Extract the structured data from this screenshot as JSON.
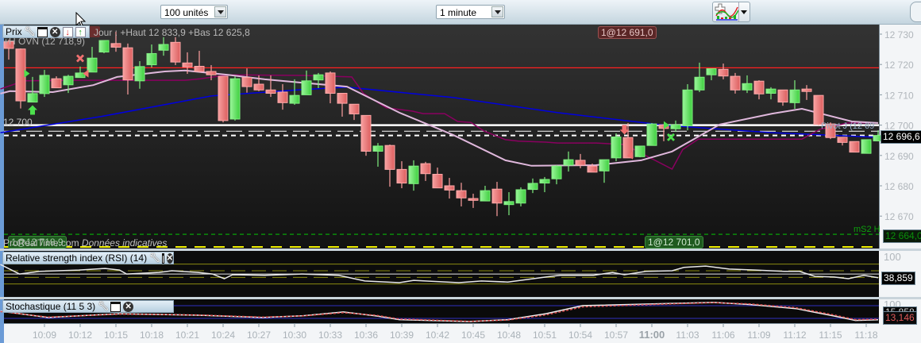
{
  "toolbar": {
    "quantity_select": "100 unités",
    "interval_select": "1 minute",
    "indicator_button": "indicators-icon"
  },
  "price_pane": {
    "title": "Prix",
    "day_stats": "Jour : +Haut 12 833,9 +Bas 12 625,8",
    "h_ovn_label": "+H OVN (12 718,9)",
    "level_12700_label": "12 700",
    "pivot_label": "Pivot J (12 69",
    "ms2_label": "mS2 H",
    "order_top_label": "1@12 691,0",
    "order_bottom_label": "1@12 701,0",
    "order_left_label": "1@12 718,9",
    "watermark": "ProRealTime.com",
    "disclaimer": "Données indicatives",
    "current_price": "12 696,6",
    "ms2_price": "12 664,0",
    "axis_ticks": [
      "12 730",
      "12 720",
      "12 710",
      "12 700",
      "12 690",
      "12 680",
      "12 670"
    ]
  },
  "rsi_pane": {
    "title": "Relative strength index (RSI) (14)",
    "axis_top": "100",
    "value": "38,859"
  },
  "stoch_pane": {
    "title": "Stochastique (11 5 3)",
    "axis_top": "100",
    "value_signal": "15,858",
    "value_main": "13,146"
  },
  "time_axis": [
    "10:09",
    "10:12",
    "10:15",
    "10:18",
    "10:21",
    "10:24",
    "10:27",
    "10:30",
    "10:33",
    "10:36",
    "10:39",
    "10:42",
    "10:45",
    "10:48",
    "10:51",
    "10:54",
    "10:57",
    "11:00",
    "11:03",
    "11:06",
    "11:09",
    "11:12",
    "11:15",
    "11:18"
  ],
  "colors": {
    "up": "#5ee05e",
    "down": "#f08484",
    "ma_slow": "#0000e0",
    "ma_fast": "#e0b8dc",
    "ma_purple": "#8a0060",
    "h_ovn": "#ff2020",
    "ms2": "#0a8a0a"
  },
  "chart_data": {
    "type": "candlestick",
    "title": "Prix",
    "xlabel": "",
    "ylabel": "",
    "x_unit": "1-minute bar index (bar 3 = 10:09, bar 72 = 11:18)",
    "ylim": [
      12662,
      12733
    ],
    "ohlc": [
      [
        12727.6,
        12728.2,
        12721.6,
        12725.3
      ],
      [
        12725.1,
        12725.3,
        12705.5,
        12708.0
      ],
      [
        12707.6,
        12715.9,
        12707.6,
        12710.4
      ],
      [
        12710.4,
        12718.2,
        12709.3,
        12716.4
      ],
      [
        12715.3,
        12716.1,
        12712.3,
        12712.3
      ],
      [
        12713.3,
        12716.6,
        12710.6,
        12716.1
      ],
      [
        12715.7,
        12719.3,
        12715.7,
        12717.2
      ],
      [
        12717.5,
        12725.8,
        12717.5,
        12722.1
      ],
      [
        12724.1,
        12727.9,
        12723.7,
        12727.9
      ],
      [
        12726.9,
        12730.8,
        12724.2,
        12725.7
      ],
      [
        12725.5,
        12726.9,
        12710.1,
        12714.9
      ],
      [
        12714.6,
        12721.1,
        12712.0,
        12719.3
      ],
      [
        12719.9,
        12726.6,
        12719.0,
        12723.6
      ],
      [
        12724.7,
        12729.0,
        12722.9,
        12726.6
      ],
      [
        12727.3,
        12729.0,
        12719.8,
        12720.8
      ],
      [
        12720.5,
        12724.0,
        12716.9,
        12719.2
      ],
      [
        12719.4,
        12724.5,
        12717.4,
        12717.7
      ],
      [
        12717.7,
        12719.8,
        12714.8,
        12716.6
      ],
      [
        12716.1,
        12716.1,
        12700.9,
        12701.5
      ],
      [
        12702.0,
        12716.1,
        12701.5,
        12715.3
      ],
      [
        12715.7,
        12718.7,
        12710.7,
        12712.7
      ],
      [
        12713.5,
        12716.4,
        12711.2,
        12711.6
      ],
      [
        12711.6,
        12716.4,
        12709.3,
        12710.5
      ],
      [
        12710.9,
        12713.5,
        12705.1,
        12707.4
      ],
      [
        12707.2,
        12715.1,
        12706.7,
        12709.8
      ],
      [
        12710.0,
        12718.0,
        12710.0,
        12714.6
      ],
      [
        12714.9,
        12717.2,
        12712.2,
        12716.6
      ],
      [
        12717.2,
        12717.7,
        12707.2,
        12710.5
      ],
      [
        12710.5,
        12710.5,
        12702.8,
        12707.2
      ],
      [
        12706.9,
        12706.9,
        12701.7,
        12703.7
      ],
      [
        12703.2,
        12703.2,
        12689.9,
        12691.4
      ],
      [
        12691.4,
        12694.1,
        12686.3,
        12693.1
      ],
      [
        12693.3,
        12693.6,
        12679.7,
        12685.4
      ],
      [
        12685.4,
        12688.1,
        12679.2,
        12680.9
      ],
      [
        12680.7,
        12688.4,
        12678.4,
        12686.5
      ],
      [
        12687.3,
        12687.9,
        12681.6,
        12684.0
      ],
      [
        12683.8,
        12686.0,
        12679.3,
        12679.3
      ],
      [
        12680.0,
        12682.6,
        12675.8,
        12678.6
      ],
      [
        12678.4,
        12681.0,
        12673.2,
        12676.0
      ],
      [
        12675.8,
        12677.4,
        12672.7,
        12675.2
      ],
      [
        12675.0,
        12680.0,
        12675.0,
        12678.4
      ],
      [
        12678.9,
        12681.3,
        12670.0,
        12674.3
      ],
      [
        12673.8,
        12677.9,
        12670.3,
        12674.8
      ],
      [
        12674.3,
        12679.5,
        12673.2,
        12678.7
      ],
      [
        12678.8,
        12682.4,
        12677.6,
        12680.8
      ],
      [
        12680.9,
        12682.9,
        12677.9,
        12682.1
      ],
      [
        12682.3,
        12686.8,
        12680.5,
        12686.5
      ],
      [
        12686.8,
        12691.3,
        12684.7,
        12688.6
      ],
      [
        12688.4,
        12690.5,
        12685.8,
        12686.8
      ],
      [
        12686.5,
        12687.3,
        12684.5,
        12684.5
      ],
      [
        12684.9,
        12688.6,
        12681.0,
        12688.6
      ],
      [
        12689.2,
        12697.3,
        12688.1,
        12696.1
      ],
      [
        12695.9,
        12700.7,
        12689.2,
        12689.2
      ],
      [
        12689.6,
        12693.1,
        12689.4,
        12693.1
      ],
      [
        12693.3,
        12700.7,
        12693.3,
        12700.4
      ],
      [
        12700.1,
        12700.2,
        12694.7,
        12698.9
      ],
      [
        12698.8,
        12701.5,
        12697.8,
        12700.1
      ],
      [
        12699.8,
        12713.5,
        12698.3,
        12711.6
      ],
      [
        12711.6,
        12720.6,
        12710.9,
        12715.8
      ],
      [
        12716.6,
        12718.6,
        12714.8,
        12718.6
      ],
      [
        12718.4,
        12720.3,
        12715.1,
        12716.2
      ],
      [
        12716.1,
        12717.2,
        12710.4,
        12711.6
      ],
      [
        12711.6,
        12716.4,
        12710.6,
        12713.7
      ],
      [
        12714.5,
        12714.8,
        12708.5,
        12710.3
      ],
      [
        12710.5,
        12712.5,
        12708.5,
        12711.9
      ],
      [
        12711.6,
        12711.6,
        12706.4,
        12707.6
      ],
      [
        12707.4,
        12714.8,
        12705.4,
        12711.6
      ],
      [
        12711.9,
        12713.2,
        12708.3,
        12711.1
      ],
      [
        12709.8,
        12709.8,
        12699.9,
        12700.2
      ],
      [
        12700.4,
        12700.9,
        12695.4,
        12695.9
      ],
      [
        12696.0,
        12696.0,
        12693.3,
        12694.3
      ],
      [
        12694.6,
        12694.6,
        12691.1,
        12691.1
      ],
      [
        12690.7,
        12695.2,
        12690.7,
        12695.2
      ],
      [
        12694.8,
        12698.3,
        12694.7,
        12696.6
      ]
    ],
    "overlays": {
      "ma_slow": [
        [
          -0.7,
          12697.5
        ],
        [
          7.7,
          12702.8
        ],
        [
          17,
          12709.6
        ],
        [
          24.6,
          12711.7
        ],
        [
          28.4,
          12712.5
        ],
        [
          37.3,
          12709.1
        ],
        [
          46.1,
          12704.1
        ],
        [
          55.3,
          12699.9
        ],
        [
          64.1,
          12697.5
        ],
        [
          73,
          12696.0
        ]
      ],
      "ma_fast": [
        [
          -0.7,
          12710.4
        ],
        [
          0.1,
          12711.2
        ],
        [
          3.7,
          12710.9
        ],
        [
          7.1,
          12713.2
        ],
        [
          9.1,
          12715.9
        ],
        [
          13.1,
          12717.7
        ],
        [
          14.8,
          12718.0
        ],
        [
          18.4,
          12716.6
        ],
        [
          21.5,
          12715.1
        ],
        [
          24.6,
          12714.0
        ],
        [
          28.4,
          12712.7
        ],
        [
          32.8,
          12704.1
        ],
        [
          37.3,
          12696.8
        ],
        [
          41.7,
          12688.4
        ],
        [
          43.9,
          12686.6
        ],
        [
          49.3,
          12686.8
        ],
        [
          53.1,
          12688.4
        ],
        [
          55.7,
          12691.3
        ],
        [
          59.7,
          12700.2
        ],
        [
          64.1,
          12703.8
        ],
        [
          66.6,
          12705.4
        ],
        [
          70.8,
          12701.2
        ],
        [
          73,
          12700.7
        ]
      ],
      "purple": [
        [
          -0.7,
          12711.9
        ],
        [
          1.3,
          12714.6
        ],
        [
          5.9,
          12714.8
        ],
        [
          14.8,
          12714.8
        ],
        [
          16.1,
          12715.3
        ],
        [
          18.4,
          12716.6
        ],
        [
          24.6,
          12716.4
        ],
        [
          28.8,
          12715.9
        ],
        [
          29.8,
          12710.4
        ],
        [
          31.7,
          12705.7
        ],
        [
          33.9,
          12704.6
        ],
        [
          34.8,
          12703.8
        ],
        [
          36.6,
          12703.8
        ],
        [
          37.7,
          12701.2
        ],
        [
          38.8,
          12700.9
        ],
        [
          39.9,
          12698.1
        ],
        [
          41.7,
          12695.2
        ],
        [
          42.8,
          12694.7
        ],
        [
          45.1,
          12694.4
        ],
        [
          46.1,
          12694.1
        ],
        [
          49.3,
          12694.1
        ],
        [
          51.7,
          12693.6
        ],
        [
          55.7,
          12685.5
        ],
        [
          56.6,
          12692.0
        ],
        [
          57.9,
          12695.4
        ],
        [
          66.6,
          12695.4
        ],
        [
          68.1,
          12698.6
        ],
        [
          70.4,
          12700.7
        ],
        [
          73,
          12700.7
        ]
      ]
    },
    "levels": {
      "h_ovn": 12718.9,
      "round_12700": 12700.0,
      "pivot": 12698.0,
      "current": 12696.6,
      "ms2": 12664.0
    },
    "signals": [
      {
        "type": "buy-arrow",
        "x": 2,
        "price": 12705
      },
      {
        "type": "entry-triangle",
        "x": 1.5,
        "price": 12717
      },
      {
        "type": "exit-cross",
        "x": 6,
        "price": 12722
      },
      {
        "type": "sell-triangle",
        "x": 6.5,
        "price": 12717
      },
      {
        "type": "sell-arrow",
        "x": 51.7,
        "price": 12698.5
      },
      {
        "type": "sell-triangle",
        "x": 52.2,
        "price": 12690
      },
      {
        "type": "entry-triangle",
        "x": 55.2,
        "price": 12700
      },
      {
        "type": "exit-cross",
        "x": 55.6,
        "price": 12696
      }
    ],
    "rsi": {
      "levels": [
        80,
        60,
        50,
        40,
        20
      ],
      "ylim": [
        0,
        100
      ],
      "values": [
        [
          -0.7,
          79
        ],
        [
          0.9,
          50
        ],
        [
          2.6,
          58
        ],
        [
          5.9,
          62
        ],
        [
          8.1,
          67
        ],
        [
          9.3,
          62
        ],
        [
          9.9,
          50
        ],
        [
          12.6,
          55
        ],
        [
          13.7,
          60
        ],
        [
          15.9,
          55
        ],
        [
          17.1,
          50
        ],
        [
          18.1,
          36
        ],
        [
          18.8,
          48
        ],
        [
          21.5,
          46
        ],
        [
          24.6,
          50
        ],
        [
          27.7,
          46
        ],
        [
          29.9,
          29
        ],
        [
          32.8,
          24
        ],
        [
          34,
          31
        ],
        [
          37.8,
          24
        ],
        [
          39.7,
          29
        ],
        [
          41.9,
          26
        ],
        [
          45.1,
          41
        ],
        [
          46.3,
          46
        ],
        [
          49.1,
          46
        ],
        [
          50.7,
          55
        ],
        [
          51.7,
          48
        ],
        [
          53.5,
          58
        ],
        [
          55.7,
          60
        ],
        [
          56.7,
          70
        ],
        [
          58.5,
          74
        ],
        [
          60.5,
          65
        ],
        [
          62.7,
          62
        ],
        [
          65.1,
          58
        ],
        [
          66.4,
          58
        ],
        [
          67.7,
          43
        ],
        [
          69.3,
          41
        ],
        [
          70.5,
          36
        ],
        [
          71.8,
          46
        ],
        [
          73,
          38.859
        ]
      ]
    },
    "stochastic": {
      "levels": [
        80,
        20
      ],
      "ylim": [
        0,
        100
      ],
      "main": [
        [
          -0.7,
          54
        ],
        [
          3.3,
          24
        ],
        [
          9.3,
          42
        ],
        [
          15.9,
          35
        ],
        [
          21.3,
          24
        ],
        [
          24.6,
          32
        ],
        [
          28.1,
          50
        ],
        [
          30.9,
          31
        ],
        [
          32.8,
          14
        ],
        [
          38.7,
          5
        ],
        [
          41.9,
          14
        ],
        [
          45.1,
          42
        ],
        [
          48.2,
          80
        ],
        [
          56.1,
          91
        ],
        [
          59.2,
          95
        ],
        [
          62.3,
          85
        ],
        [
          66.1,
          66
        ],
        [
          69.3,
          31
        ],
        [
          71.1,
          10
        ],
        [
          73,
          13.146
        ]
      ],
      "signal": [
        [
          -0.7,
          52
        ],
        [
          3.3,
          26
        ],
        [
          9.3,
          40
        ],
        [
          15.9,
          36
        ],
        [
          21.3,
          26
        ],
        [
          24.6,
          31
        ],
        [
          28.1,
          47
        ],
        [
          30.9,
          34
        ],
        [
          32.8,
          17
        ],
        [
          38.7,
          6
        ],
        [
          41.9,
          12
        ],
        [
          45.1,
          36
        ],
        [
          48.2,
          74
        ],
        [
          56.1,
          89
        ],
        [
          59.2,
          94
        ],
        [
          62.3,
          88
        ],
        [
          66.1,
          70
        ],
        [
          69.3,
          36
        ],
        [
          71.1,
          14
        ],
        [
          73,
          15.858
        ]
      ]
    }
  }
}
